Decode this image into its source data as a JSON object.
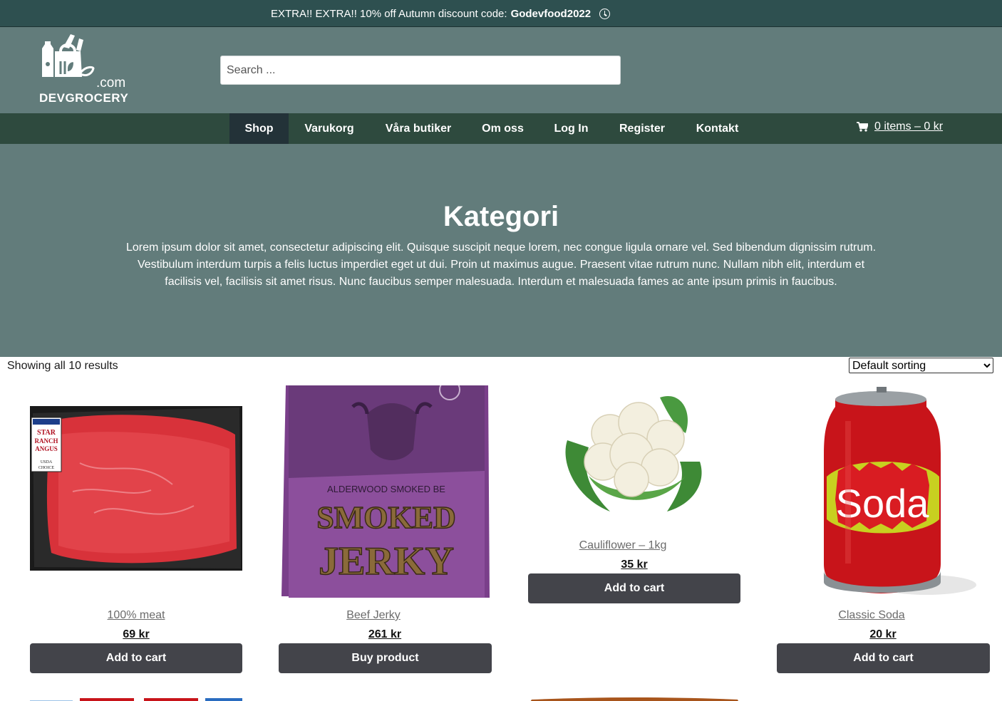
{
  "announcement": {
    "text": "EXTRA!! EXTRA!! 10% off Autumn discount code:",
    "code": "Godevfood2022",
    "icon": "clock-icon"
  },
  "header": {
    "logo": {
      "dotcom": ".com",
      "wordmark": "DEVGROCERY"
    },
    "search": {
      "placeholder": "Search ..."
    }
  },
  "nav": {
    "items": [
      {
        "label": "Shop",
        "active": true
      },
      {
        "label": "Varukorg"
      },
      {
        "label": "Våra butiker"
      },
      {
        "label": "Om oss"
      },
      {
        "label": "Log In"
      },
      {
        "label": "Register"
      },
      {
        "label": "Kontakt"
      }
    ],
    "cart": {
      "label": "0 items – 0 kr",
      "icon": "shopping-cart-icon"
    }
  },
  "hero": {
    "title": "Kategori",
    "description": "Lorem ipsum dolor sit amet, consectetur adipiscing elit. Quisque suscipit neque lorem, nec congue ligula ornare vel. Sed bibendum dignissim rutrum. Vestibulum interdum turpis a felis luctus imperdiet eget ut dui. Proin ut maximus augue. Praesent vitae rutrum nunc. Nullam nibh elit, interdum et facilisis vel, facilisis sit amet risus. Nunc faucibus semper malesuada. Interdum et malesuada fames ac ante ipsum primis in faucibus."
  },
  "shop": {
    "result_count": "Showing all 10 results",
    "sorting": {
      "selected": "Default sorting"
    },
    "products": [
      {
        "title": "100% meat",
        "price": "69 kr",
        "button": "Add to cart",
        "image": "steak-image",
        "image_text": "STAR RANCH ANGUS"
      },
      {
        "title": "Beef Jerky",
        "price": "261 kr",
        "button": "Buy product",
        "image": "jerky-bag-image",
        "image_text": "SMOKED JERKY"
      },
      {
        "title": "Cauliflower – 1kg",
        "price": "35 kr",
        "button": "Add to cart",
        "image": "cauliflower-image"
      },
      {
        "title": "Classic Soda",
        "price": "20 kr",
        "button": "Add to cart",
        "image": "soda-can-image",
        "image_text": "Soda"
      }
    ]
  },
  "colors": {
    "topbar": "#2e5050",
    "header": "#627c7b",
    "nav": "#2e4a3e",
    "nav_active": "#233238",
    "button": "#43444a"
  }
}
